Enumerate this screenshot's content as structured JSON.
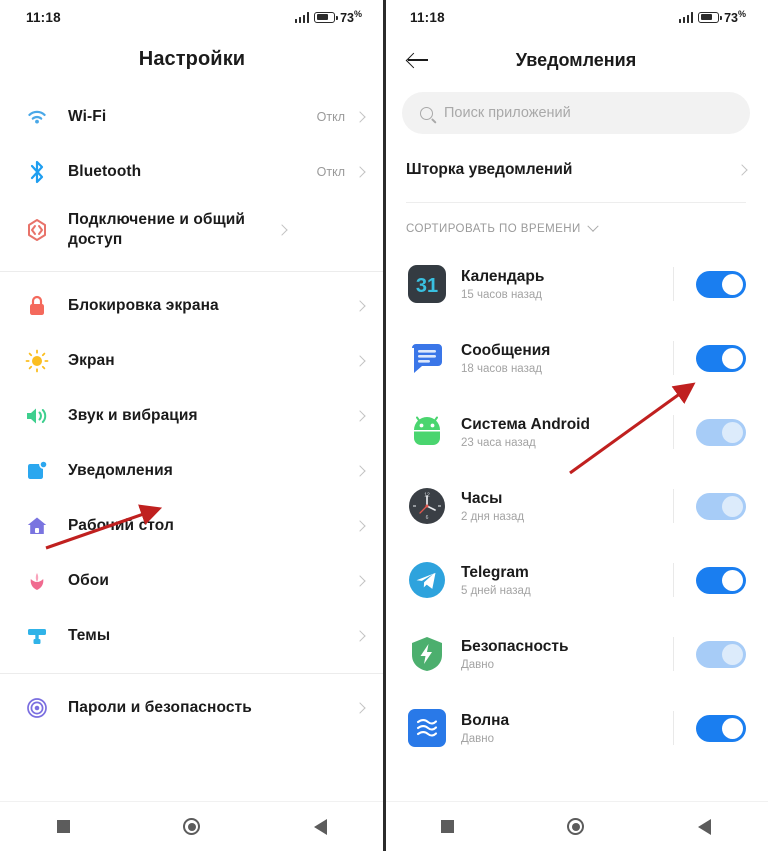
{
  "statusbar": {
    "time": "11:18",
    "battery_percent": "73",
    "percent_symbol": "%",
    "signal_icon": "cellular-signal-icon",
    "battery_icon": "battery-icon"
  },
  "colors": {
    "accent_blue": "#1a7ef0",
    "dim_blue": "#a7ccf7",
    "text_primary": "#1b1b1b",
    "text_secondary": "#9a9a9a",
    "annotation_red": "#c0201f",
    "divider": "#ededed"
  },
  "settings_screen": {
    "title": "Настройки",
    "groups": [
      {
        "items": [
          {
            "icon": "wifi-icon",
            "label": "Wi-Fi",
            "value": "Откл",
            "chevron": true
          },
          {
            "icon": "bluetooth-icon",
            "label": "Bluetooth",
            "value": "Откл",
            "chevron": true
          },
          {
            "icon": "sharing-icon",
            "label": "Подключение и общий доступ",
            "value": "",
            "chevron": true
          }
        ]
      },
      {
        "items": [
          {
            "icon": "lock-icon",
            "label": "Блокировка экрана",
            "value": "",
            "chevron": true
          },
          {
            "icon": "brightness-icon",
            "label": "Экран",
            "value": "",
            "chevron": true
          },
          {
            "icon": "volume-icon",
            "label": "Звук и вибрация",
            "value": "",
            "chevron": true
          },
          {
            "icon": "notification-icon",
            "label": "Уведомления",
            "value": "",
            "chevron": true
          },
          {
            "icon": "home-icon",
            "label": "Рабочий стол",
            "value": "",
            "chevron": true
          },
          {
            "icon": "wallpaper-icon",
            "label": "Обои",
            "value": "",
            "chevron": true
          },
          {
            "icon": "themes-icon",
            "label": "Темы",
            "value": "",
            "chevron": true
          }
        ]
      },
      {
        "items": [
          {
            "icon": "fingerprint-icon",
            "label": "Пароли и безопасность",
            "value": "",
            "chevron": true
          }
        ]
      }
    ]
  },
  "notifications_screen": {
    "title": "Уведомления",
    "back_icon": "back-arrow-icon",
    "search": {
      "placeholder": "Поиск приложений",
      "icon": "search-icon"
    },
    "shade_row": {
      "label": "Шторка уведомлений",
      "chevron": true
    },
    "sort": {
      "label": "СОРТИРОВАТЬ ПО ВРЕМЕНИ",
      "icon": "chevron-down-icon"
    },
    "apps": [
      {
        "icon": "calendar-app-icon",
        "name": "Календарь",
        "time": "15 часов назад",
        "enabled": true,
        "dimmed": false
      },
      {
        "icon": "messages-app-icon",
        "name": "Сообщения",
        "time": "18 часов назад",
        "enabled": true,
        "dimmed": false
      },
      {
        "icon": "android-app-icon",
        "name": "Система Android",
        "time": "23 часа назад",
        "enabled": true,
        "dimmed": true
      },
      {
        "icon": "clock-app-icon",
        "name": "Часы",
        "time": "2 дня назад",
        "enabled": true,
        "dimmed": true
      },
      {
        "icon": "telegram-app-icon",
        "name": "Telegram",
        "time": "5 дней назад",
        "enabled": true,
        "dimmed": false
      },
      {
        "icon": "security-app-icon",
        "name": "Безопасность",
        "time": "Давно",
        "enabled": true,
        "dimmed": true
      },
      {
        "icon": "volna-app-icon",
        "name": "Волна",
        "time": "Давно",
        "enabled": true,
        "dimmed": false
      }
    ]
  },
  "navbar": {
    "recents_icon": "recents-square-icon",
    "home_icon": "home-circle-icon",
    "back_icon": "back-triangle-icon"
  },
  "annotations": [
    {
      "name": "arrow-to-notifications-item",
      "description": "red arrow pointing at Уведомления row"
    },
    {
      "name": "arrow-to-messages-toggle",
      "description": "red arrow pointing at Сообщения toggle"
    }
  ]
}
